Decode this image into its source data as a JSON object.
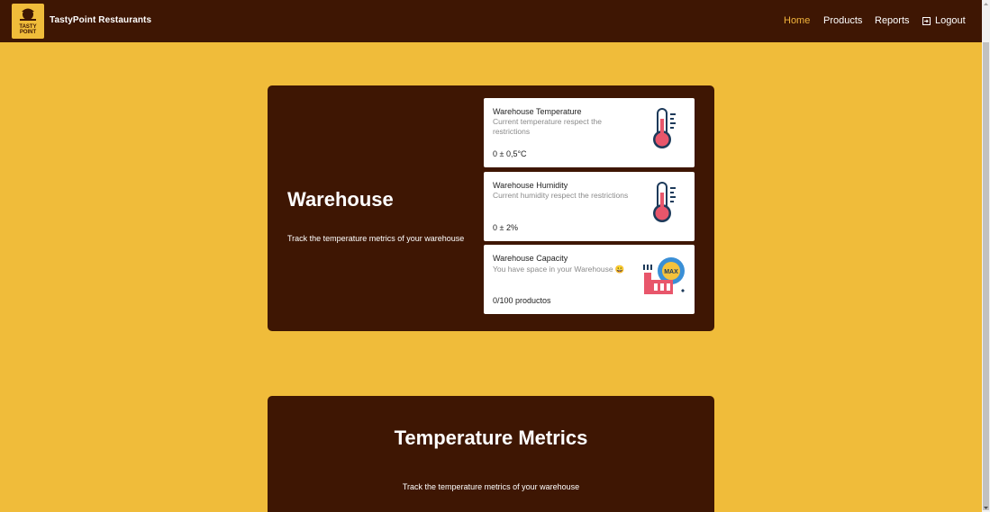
{
  "navbar": {
    "brand_name": "TastyPoint Restaurants",
    "logo_text_top": "TASTY",
    "logo_text_bottom": "POINT",
    "links": {
      "home": "Home",
      "products": "Products",
      "reports": "Reports",
      "logout": "Logout"
    }
  },
  "warehouse": {
    "title": "Warehouse",
    "description": "Track the temperature metrics of your warehouse",
    "cards": [
      {
        "title": "Warehouse Temperature",
        "subtitle": "Current temperature respect the restrictions",
        "value": "0 ± 0,5°C",
        "icon": "thermometer-icon"
      },
      {
        "title": "Warehouse Humidity",
        "subtitle": "Current humidity respect the restrictions",
        "value": "0 ± 2%",
        "icon": "thermometer-icon"
      },
      {
        "title": "Warehouse Capacity",
        "subtitle": "You have space in your Warehouse 😀",
        "value": "0/100 productos",
        "icon": "factory-capacity-icon",
        "icon_badge_text": "MAX"
      }
    ]
  },
  "temperature_metrics": {
    "title": "Temperature Metrics",
    "description": "Track the temperature metrics of your warehouse"
  },
  "colors": {
    "background": "#f0bc3a",
    "panel": "#3e1603",
    "active_link": "#f2b43c"
  }
}
